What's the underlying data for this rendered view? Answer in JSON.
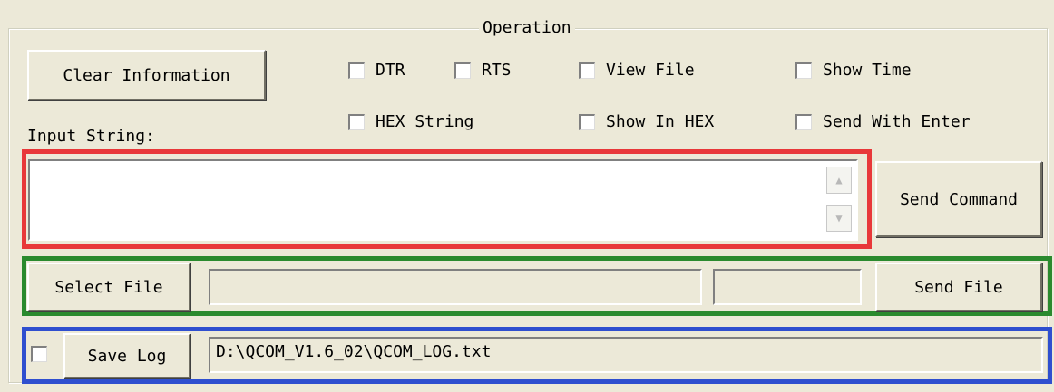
{
  "group": {
    "title": "Operation"
  },
  "buttons": {
    "clear_info": "Clear Information",
    "send_command": "Send Command",
    "select_file": "Select File",
    "send_file": "Send File",
    "save_log": "Save Log"
  },
  "checkboxes": {
    "dtr": {
      "label": "DTR",
      "checked": false
    },
    "rts": {
      "label": "RTS",
      "checked": false
    },
    "view_file": {
      "label": "View File",
      "checked": false
    },
    "show_time": {
      "label": "Show Time",
      "checked": false
    },
    "hex_string": {
      "label": "HEX String",
      "checked": false
    },
    "show_in_hex": {
      "label": "Show In HEX",
      "checked": false
    },
    "send_with_enter": {
      "label": "Send With Enter",
      "checked": false
    },
    "save_log_enable": {
      "checked": false
    }
  },
  "input": {
    "label": "Input String:",
    "value": ""
  },
  "file": {
    "path": "",
    "extra": ""
  },
  "log": {
    "path": "D:\\QCOM_V1.6_02\\QCOM_LOG.txt"
  },
  "highlights": {
    "input_color": "#e8383a",
    "file_color": "#2a8a2e",
    "log_color": "#2f4fcf"
  }
}
